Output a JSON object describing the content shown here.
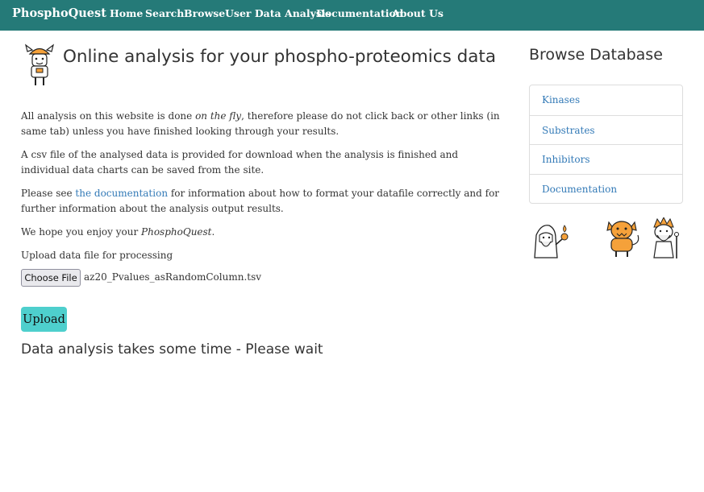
{
  "navbar": {
    "brand": "PhosphoQuest",
    "links": [
      {
        "label": "Home"
      },
      {
        "label": "Search"
      },
      {
        "label": "Browse"
      },
      {
        "label": "User Data Analysis"
      },
      {
        "label": "Documentation"
      },
      {
        "label": "About Us"
      }
    ],
    "background": "#257a78"
  },
  "main": {
    "title": "Online analysis for your phospho-proteomics data",
    "p1": {
      "before": "All analysis on this website is done ",
      "em": "on the fly",
      "after": ", therefore please do not click back or other links (in same tab) unless you have finished looking through your results."
    },
    "p2": "A csv file of the analysed data is provided for download when the analysis is finished and individual data charts can be saved from the site.",
    "p3": {
      "before": "Please see ",
      "link": "the documentation",
      "after": " for information about how to format your datafile correctly and for further information about the analysis output results."
    },
    "p4": {
      "before": "We hope you enjoy your ",
      "em": "PhosphoQuest",
      "after": "."
    },
    "upload_label": "Upload data file for processing",
    "choose_file_label": "Choose File",
    "file_name": "az20_Pvalues_asRandomColumn.tsv",
    "upload_button": "Upload",
    "wait_message": "Data analysis takes some time - Please wait"
  },
  "sidebar": {
    "title": "Browse Database",
    "items": [
      {
        "label": "Kinases"
      },
      {
        "label": "Substrates"
      },
      {
        "label": "Inhibitors"
      },
      {
        "label": "Documentation"
      }
    ]
  },
  "colors": {
    "accent": "#4ecfcd",
    "link": "#337ab7",
    "mascot_orange": "#f5a13a"
  },
  "icons": [
    "viking-mascot-icon",
    "wizard-mascot-icon",
    "orange-creature-icon",
    "old-sage-icon"
  ]
}
